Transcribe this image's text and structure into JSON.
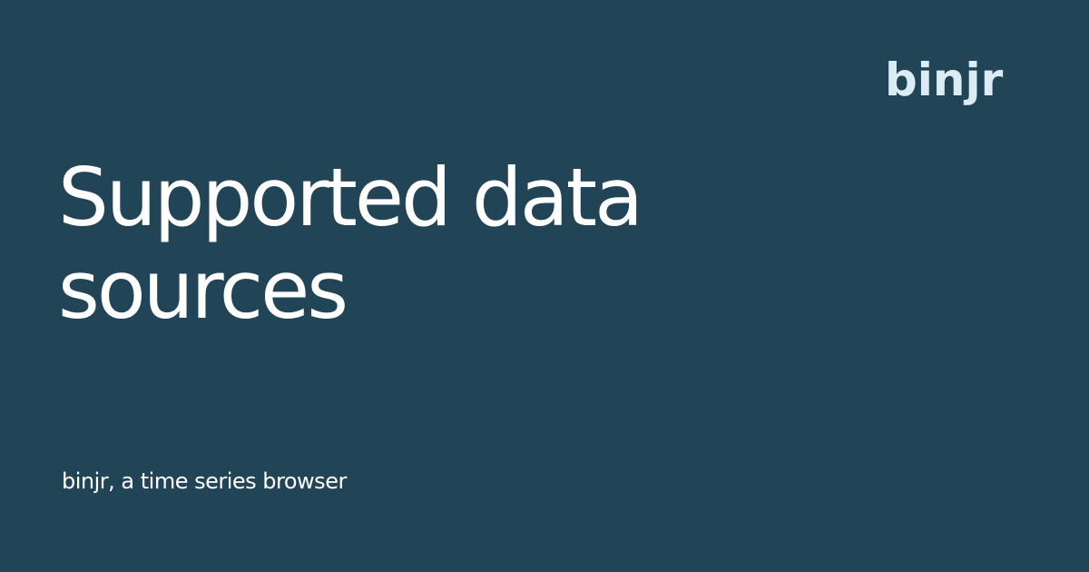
{
  "brand": {
    "logo_text": "binjr"
  },
  "page": {
    "title": "Supported data sources",
    "subtitle": "binjr, a time series browser"
  },
  "colors": {
    "background": "#224457",
    "title_text": "#ffffff",
    "logo_text": "#dbecf4"
  }
}
